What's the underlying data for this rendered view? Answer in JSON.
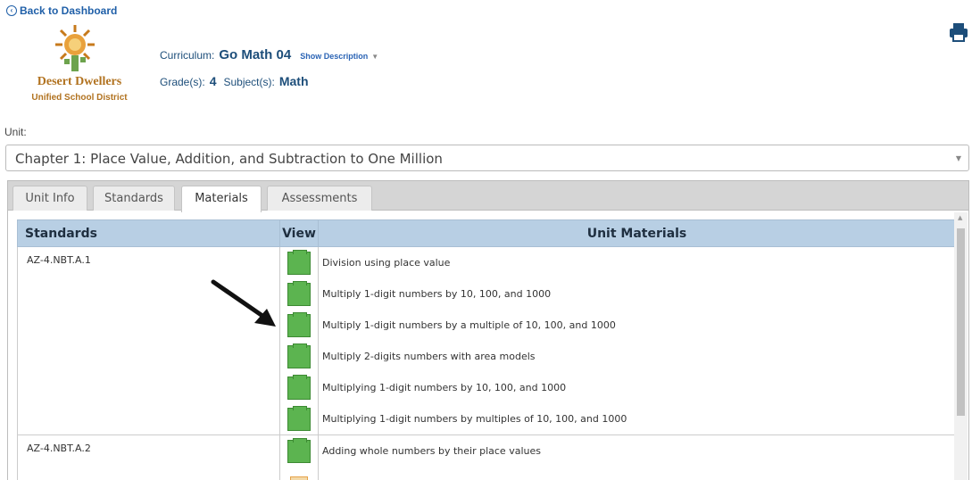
{
  "back_link": "Back to Dashboard",
  "logo": {
    "line1": "Desert Dwellers",
    "line2": "Unified School District"
  },
  "header": {
    "curriculum_label": "Curriculum:",
    "curriculum_value": "Go Math 04",
    "show_description": "Show Description",
    "grade_label": "Grade(s):",
    "grade_value": "4",
    "subject_label": "Subject(s):",
    "subject_value": "Math"
  },
  "unit": {
    "label": "Unit:",
    "selected": "Chapter 1: Place Value, Addition, and Subtraction to One Million"
  },
  "tabs": [
    {
      "label": "Unit Info"
    },
    {
      "label": "Standards"
    },
    {
      "label": "Materials"
    },
    {
      "label": "Assessments"
    }
  ],
  "active_tab": "Materials",
  "table": {
    "headers": {
      "standards": "Standards",
      "view": "View",
      "materials": "Unit Materials"
    },
    "groups": [
      {
        "standard": "AZ-4.NBT.A.1",
        "materials": [
          "Division using place value",
          "Multiply 1-digit numbers by 10, 100, and 1000",
          "Multiply 1-digit numbers by a multiple of 10, 100, and 1000",
          "Multiply 2-digits numbers with area models",
          "Multiplying 1-digit numbers by 10, 100, and 1000",
          "Multiplying 1-digit numbers by multiples of 10, 100, and 1000"
        ]
      },
      {
        "standard": "AZ-4.NBT.A.2",
        "materials": [
          "Adding whole numbers by their place values",
          ""
        ]
      }
    ]
  },
  "colors": {
    "link": "#1f5fa8",
    "header_bg": "#b8cfe4",
    "view_icon": "#5cb450",
    "logo_text": "#b1721f"
  },
  "icons": [
    "back-circle-icon",
    "printer-icon",
    "dropdown-caret-icon",
    "folder-icon",
    "document-icon",
    "arrow-pointer-icon"
  ]
}
